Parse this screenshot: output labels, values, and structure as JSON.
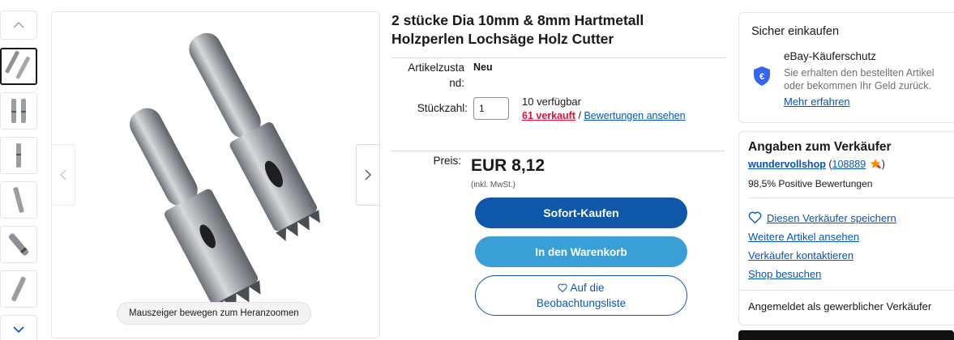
{
  "product": {
    "title_line1": "2 stücke Dia 10mm & 8mm Hartmetall",
    "title_line2": "Holzperlen Lochsäge Holz Cutter"
  },
  "gallery": {
    "zoom_hint": "Mauszeiger bewegen zum Heranzoomen",
    "thumbnail_count": 6,
    "selected_index": 0
  },
  "details": {
    "condition_label_line1": "Artikelzusta",
    "condition_label_line2": "nd:",
    "condition_value": "Neu",
    "quantity_label": "Stückzahl:",
    "quantity_value": "1",
    "available": "10 verfügbar",
    "sold": "61 verkauft",
    "separator": "/",
    "reviews_link": "Bewertungen ansehen"
  },
  "pricing": {
    "price_label": "Preis:",
    "price": "EUR 8,12",
    "vat_note": "(inkl. MwSt.)"
  },
  "actions": {
    "buy_now": "Sofort-Kaufen",
    "add_to_cart": "In den Warenkorb",
    "watch_line1": "Auf die",
    "watch_line2": "Beobachtungsliste"
  },
  "safe_shopping": {
    "title": "Sicher einkaufen",
    "protection_title": "eBay-Käuferschutz",
    "protection_text_line1": "Sie erhalten den bestellten Artikel",
    "protection_text_line2": "oder bekommen Ihr Geld zurück.",
    "learn_more": "Mehr erfahren"
  },
  "seller": {
    "title": "Angaben zum Verkäufer",
    "name": "wundervollshop",
    "open_paren": "(",
    "feedback_score": "108889",
    "close_paren": ")",
    "positive": "98,5% Positive Bewertungen",
    "save_seller": "Diesen Verkäufer speichern",
    "more_items": "Weitere Artikel ansehen",
    "contact": "Verkäufer kontaktieren",
    "visit_shop": "Shop besuchen",
    "business_note": "Angemeldet als gewerblicher Verkäufer"
  },
  "colors": {
    "primary_blue": "#0f57a8",
    "cart_blue": "#3a9fd4",
    "link_blue": "#0654ba",
    "sold_red": "#e0103a"
  }
}
